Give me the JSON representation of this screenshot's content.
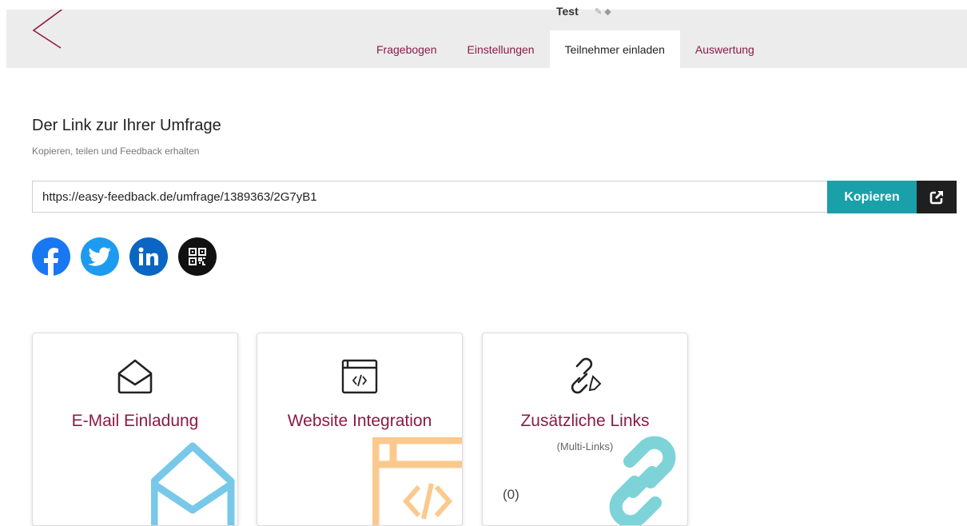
{
  "header": {
    "survey_title": "Test",
    "tabs": [
      {
        "label": "Fragebogen"
      },
      {
        "label": "Einstellungen"
      },
      {
        "label": "Teilnehmer einladen"
      },
      {
        "label": "Auswertung"
      }
    ],
    "active_tab": "Teilnehmer einladen"
  },
  "link_section": {
    "title": "Der Link zur Ihrer Umfrage",
    "subtitle": "Kopieren, teilen und Feedback erhalten",
    "url": "https://easy-feedback.de/umfrage/1389363/2G7yB1",
    "copy_label": "Kopieren"
  },
  "share_icons": [
    "facebook-icon",
    "twitter-icon",
    "linkedin-icon",
    "qr-code-icon"
  ],
  "cards": [
    {
      "label": "E-Mail Einladung",
      "icon": "envelope-open-icon"
    },
    {
      "label": "Website Integration",
      "icon": "code-window-icon"
    },
    {
      "label": "Zusätzliche Links",
      "sublabel": "(Multi-Links)",
      "count": "(0)",
      "icon": "link-icon"
    }
  ],
  "colors": {
    "accent": "#8c1a44",
    "copy_button": "#1aa0a9",
    "facebook": "#1877f2",
    "twitter": "#1d9bf0",
    "linkedin": "#0a66c2"
  }
}
